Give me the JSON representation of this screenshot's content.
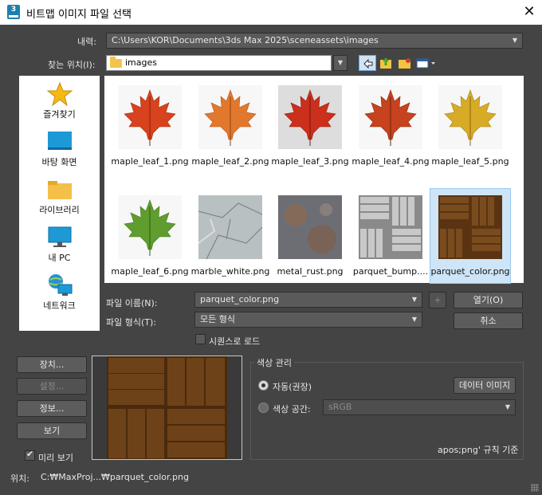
{
  "window": {
    "title": "비트맵 이미지 파일 선택",
    "app_badge": "3"
  },
  "history": {
    "label": "내력:",
    "path": "C:\\Users\\KOR\\Documents\\3ds Max 2025\\sceneassets\\images"
  },
  "look_in": {
    "label": "찾는 위치(I):",
    "folder": "images"
  },
  "sidebar": {
    "items": [
      {
        "label": "즐겨찾기",
        "icon": "star-icon"
      },
      {
        "label": "바탕 화면",
        "icon": "desktop-icon"
      },
      {
        "label": "라이브러리",
        "icon": "library-folder-icon"
      },
      {
        "label": "내 PC",
        "icon": "this-pc-icon"
      },
      {
        "label": "네트워크",
        "icon": "network-icon"
      }
    ]
  },
  "files": [
    {
      "name": "maple_leaf_1.png",
      "thumb": "red-maple-leaf"
    },
    {
      "name": "maple_leaf_2.png",
      "thumb": "orange-maple-leaf"
    },
    {
      "name": "maple_leaf_3.png",
      "thumb": "red-maple-leaf-grey-bg"
    },
    {
      "name": "maple_leaf_4.png",
      "thumb": "dark-red-maple-leaf"
    },
    {
      "name": "maple_leaf_5.png",
      "thumb": "yellow-maple-leaf"
    },
    {
      "name": "maple_leaf_6.png",
      "thumb": "green-maple-leaf"
    },
    {
      "name": "marble_white.png",
      "thumb": "marble-texture"
    },
    {
      "name": "metal_rust.png",
      "thumb": "rust-texture"
    },
    {
      "name": "parquet_bump....",
      "thumb": "parquet-bump-texture"
    },
    {
      "name": "parquet_color.png",
      "thumb": "parquet-color-texture",
      "selected": true
    }
  ],
  "filename": {
    "label": "파일 이름(N):",
    "value": "parquet_color.png"
  },
  "filetype": {
    "label": "파일 형식(T):",
    "value": "모든 형식"
  },
  "sequence": {
    "label": "시퀀스로 로드",
    "checked": false
  },
  "buttons": {
    "open": "열기(O)",
    "cancel": "취소",
    "plus": "+",
    "devices": "장치...",
    "setup": "설정...",
    "info": "정보...",
    "view": "보기"
  },
  "preview_check": {
    "label": "미리 보기",
    "checked": true
  },
  "color_mgmt": {
    "title": "색상 관리",
    "auto_label": "자동(권장)",
    "data_image_button": "데이터 이미지",
    "color_space_label": "색상 공간:",
    "color_space_value": "sRGB",
    "rule_text": "apos;png' 규칙 기준"
  },
  "status": {
    "label": "위치:",
    "path": "C:₩MaxProj...₩parquet_color.png"
  },
  "colors": {
    "background": "#444444",
    "selection": "#cde5f7",
    "accent": "#1f7fae"
  }
}
